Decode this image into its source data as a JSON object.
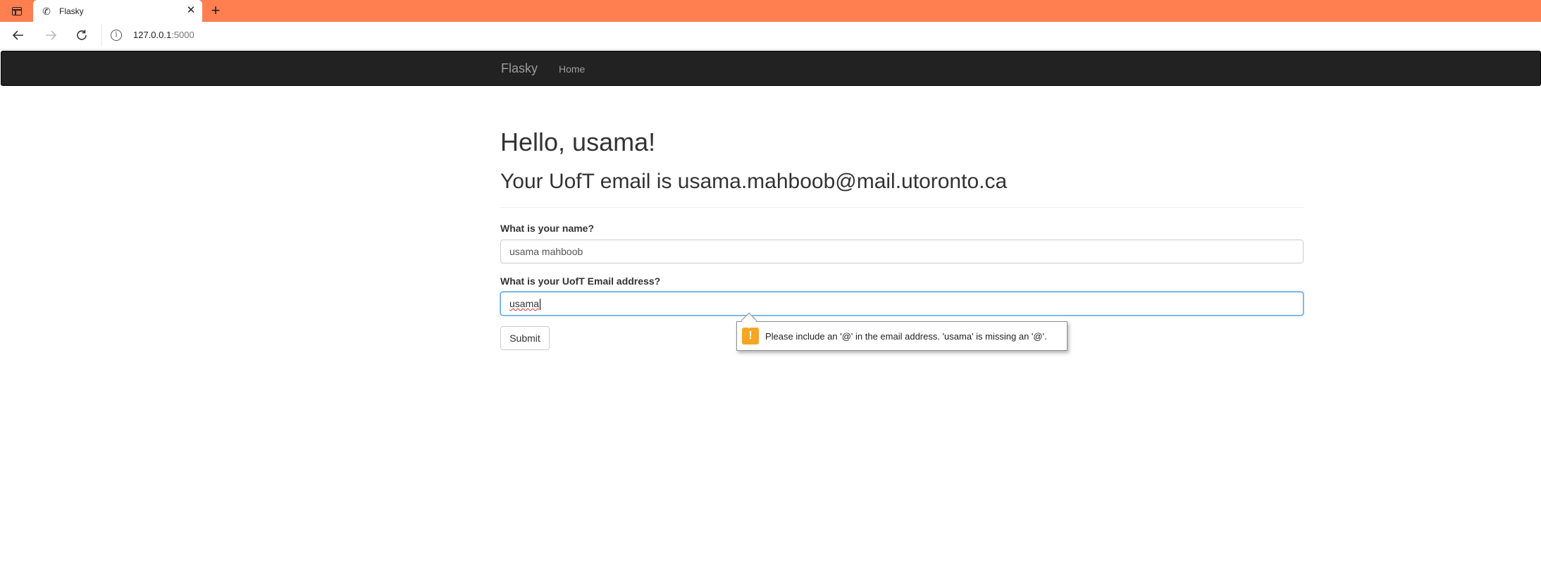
{
  "browser": {
    "tab": {
      "title": "Flasky",
      "favicon": "phone-icon"
    },
    "url": {
      "host": "127.0.0.1",
      "port": ":5000"
    },
    "accent": "#ff7f50"
  },
  "navbar": {
    "brand": "Flasky",
    "links": [
      {
        "label": "Home"
      }
    ]
  },
  "main": {
    "greeting": "Hello, usama!",
    "email_line": "Your UofT email is usama.mahboob@mail.utoronto.ca",
    "form": {
      "name_label": "What is your name?",
      "name_value": "usama mahboob",
      "email_label": "What is your UofT Email address?",
      "email_value": "usama",
      "submit_label": "Submit"
    },
    "validation": {
      "icon": "warning-icon",
      "message": "Please include an '@' in the email address. 'usama' is missing an '@'."
    }
  }
}
